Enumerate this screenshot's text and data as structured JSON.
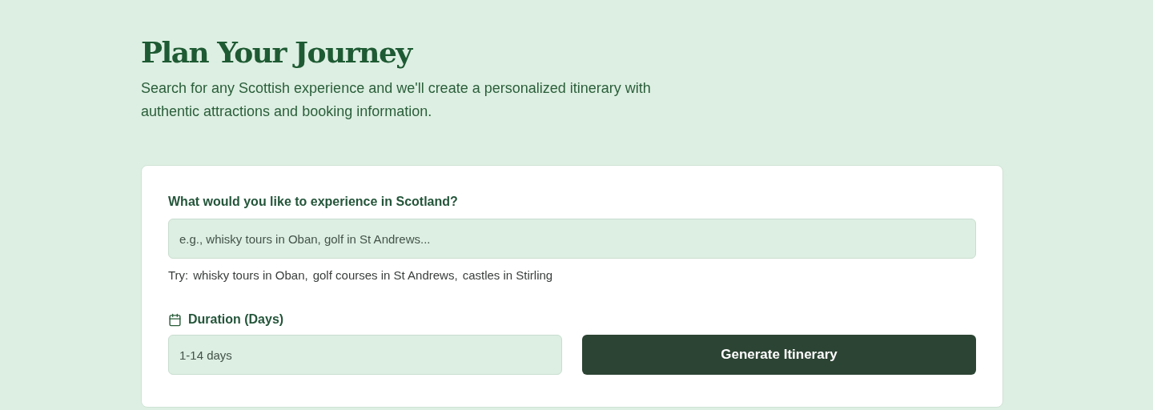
{
  "header": {
    "title": "Plan Your Journey",
    "subtitle": "Search for any Scottish experience and we'll create a personalized itinerary with authentic attractions and booking information."
  },
  "form": {
    "question": "What would you like to experience in Scotland?",
    "search": {
      "placeholder": "e.g., whisky tours in Oban, golf in St Andrews..."
    },
    "try_label": "Try:",
    "suggestions": [
      "whisky tours in Oban,",
      "golf courses in St Andrews,",
      "castles in Stirling"
    ],
    "duration_label": "Duration (Days)",
    "duration": {
      "placeholder": "1-14 days"
    },
    "button": "Generate Itinerary"
  }
}
